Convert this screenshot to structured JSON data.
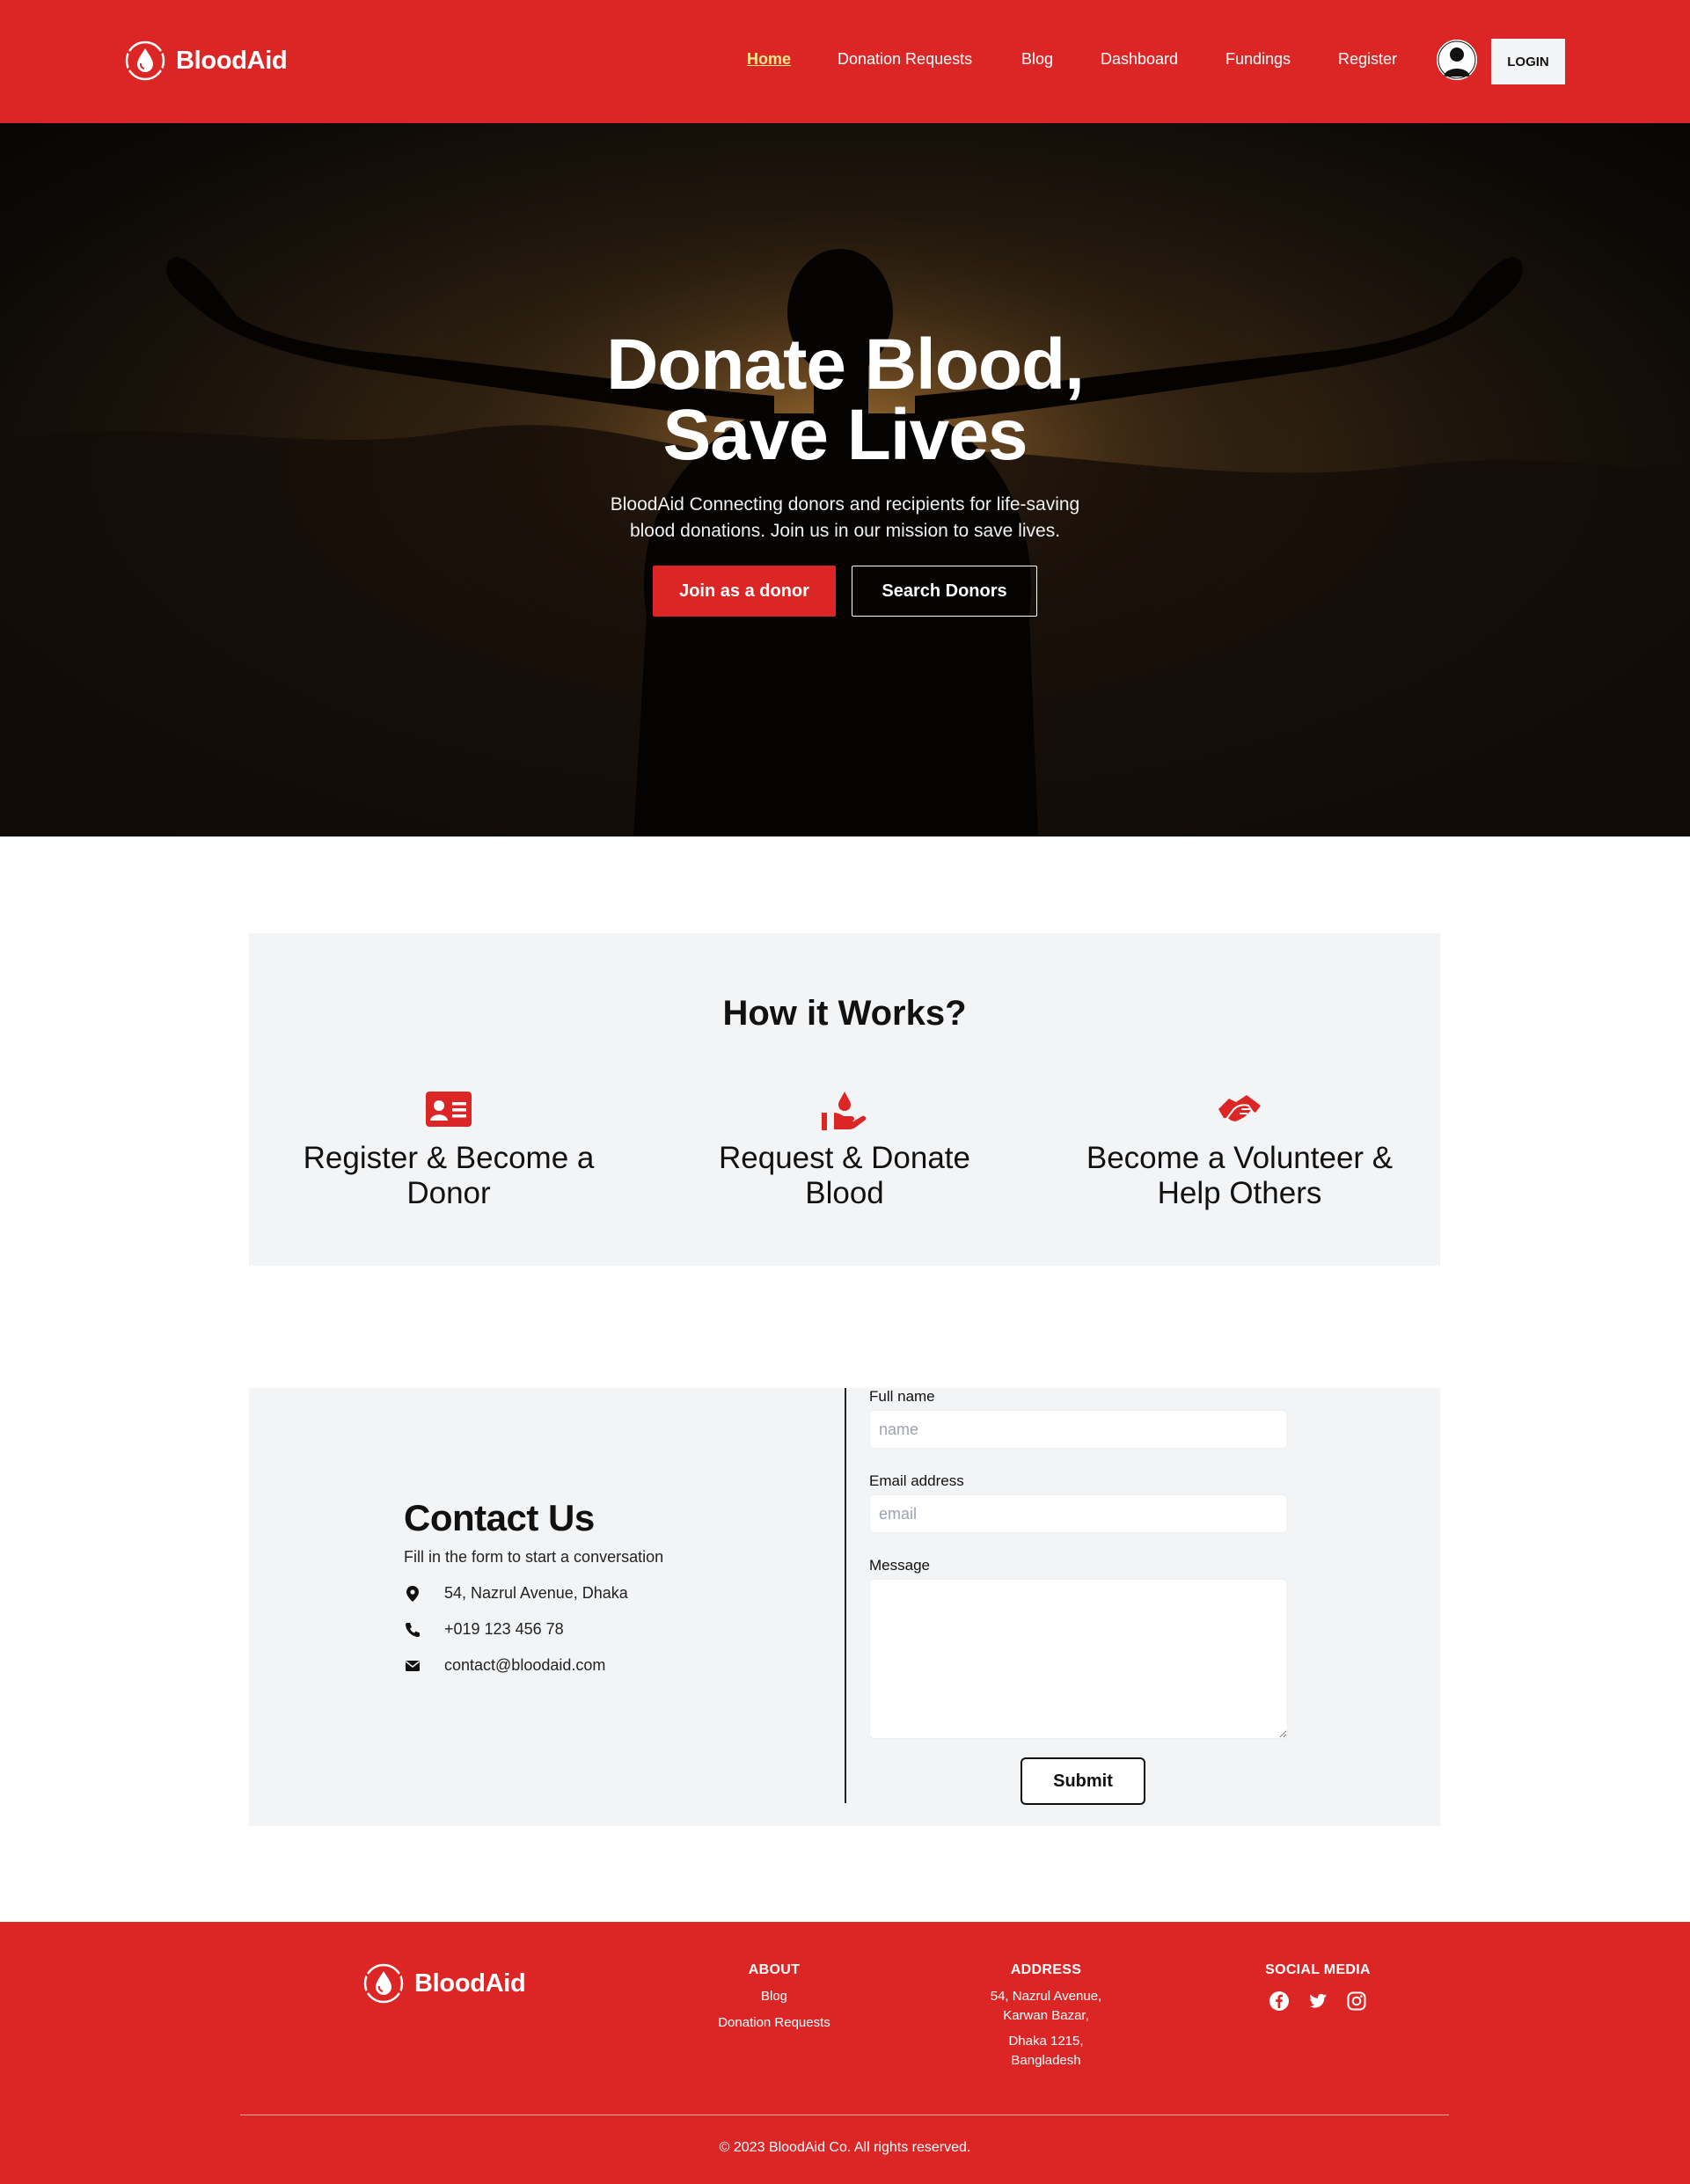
{
  "colors": {
    "brand_red": "#dc2626",
    "active_link": "#fde68a",
    "panel_bg": "#f3f4f6"
  },
  "brand": {
    "name": "BloodAid",
    "icon": "blood-drop-logo-icon"
  },
  "nav": {
    "links": [
      "Home",
      "Donation Requests",
      "Blog",
      "Dashboard",
      "Fundings",
      "Register"
    ],
    "active": "Home",
    "avatar_icon": "user-avatar-icon",
    "login_label": "LOGIN"
  },
  "hero": {
    "title_line1": "Donate Blood,",
    "title_line2": "Save Lives",
    "subtitle": "BloodAid Connecting donors and recipients for life-saving blood donations. Join us in our mission to save lives.",
    "primary_button": "Join as a donor",
    "secondary_button": "Search Donors"
  },
  "how": {
    "title": "How it Works?",
    "items": [
      {
        "label": "Register & Become a Donor",
        "icon": "id-card-icon"
      },
      {
        "label": "Request & Donate Blood",
        "icon": "hand-holding-drop-icon"
      },
      {
        "label": "Become a Volunteer & Help Others",
        "icon": "handshake-icon"
      }
    ]
  },
  "contact": {
    "title": "Contact Us",
    "subtitle": "Fill in the form to start a conversation",
    "address": "54, Nazrul Avenue, Dhaka",
    "phone": "+019 123 456 78",
    "email": "contact@bloodaid.com",
    "form": {
      "name_label": "Full name",
      "name_placeholder": "name",
      "email_label": "Email address",
      "email_placeholder": "email",
      "message_label": "Message",
      "submit_label": "Submit"
    }
  },
  "footer": {
    "about_title": "ABOUT",
    "about_links": [
      "Blog",
      "Donation Requests"
    ],
    "address_title": "ADDRESS",
    "address_line1": "54, Nazrul Avenue,",
    "address_line2": "Karwan Bazar,",
    "address_line3": "Dhaka 1215,",
    "address_line4": "Bangladesh",
    "social_title": "SOCIAL MEDIA",
    "social_icons": [
      "facebook-icon",
      "twitter-icon",
      "instagram-icon"
    ],
    "copyright": "© 2023 BloodAid Co. All rights reserved."
  }
}
